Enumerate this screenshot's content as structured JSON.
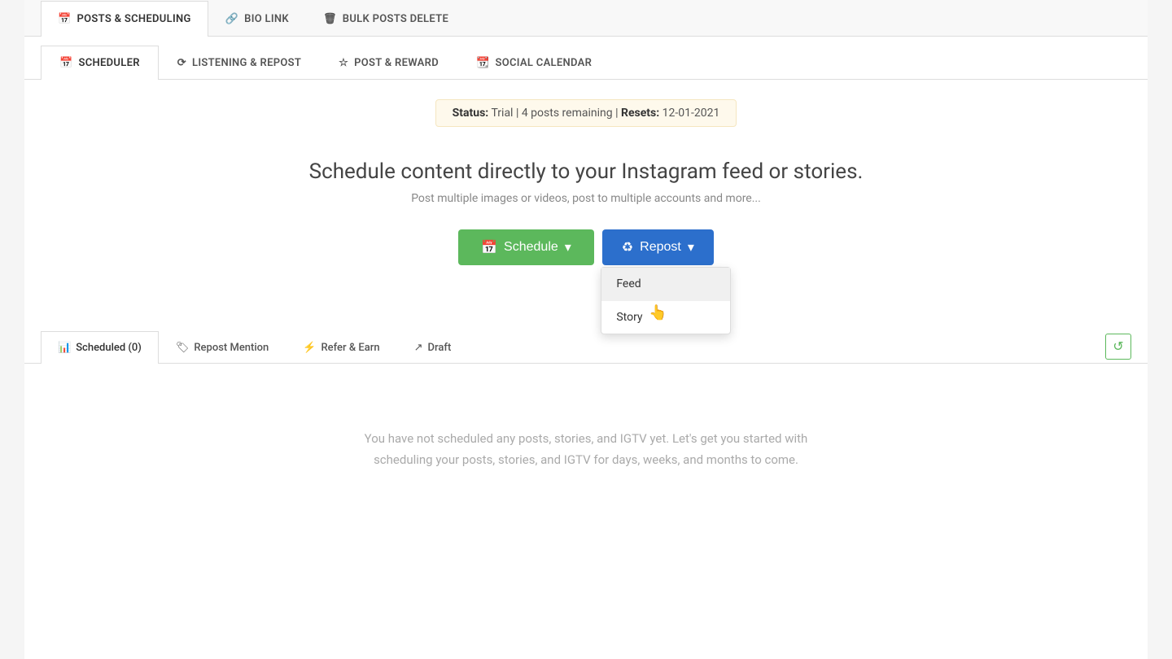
{
  "top_tabs": [
    {
      "id": "posts-scheduling",
      "icon": "📅",
      "label": "POSTS & SCHEDULING",
      "active": true
    },
    {
      "id": "bio-link",
      "icon": "🔗",
      "label": "BIO LINK",
      "active": false
    },
    {
      "id": "bulk-posts-delete",
      "icon": "🗑",
      "label": "Bulk Posts Delete",
      "active": false
    }
  ],
  "sub_tabs": [
    {
      "id": "scheduler",
      "icon": "📅",
      "label": "SCHEDULER",
      "active": true
    },
    {
      "id": "listening-repost",
      "icon": "⟳",
      "label": "LISTENING & REPOST",
      "active": false
    },
    {
      "id": "post-reward",
      "icon": "☆",
      "label": "POST & REWARD",
      "active": false
    },
    {
      "id": "social-calendar",
      "icon": "📆",
      "label": "SOCIAL CALENDAR",
      "active": false
    }
  ],
  "status": {
    "label": "Status:",
    "status_value": "Trial",
    "separator1": "|",
    "posts_label": "4 posts remaining",
    "separator2": "|",
    "resets_label": "Resets:",
    "resets_value": "12-01-2021"
  },
  "main": {
    "heading": "Schedule content directly to your Instagram feed or stories.",
    "subheading": "Post multiple images or videos, post to multiple accounts and more...",
    "schedule_button": "Schedule",
    "repost_button": "Repost",
    "dropdown_items": [
      {
        "id": "feed",
        "label": "Feed"
      },
      {
        "id": "story",
        "label": "Story"
      }
    ]
  },
  "bottom_tabs": [
    {
      "id": "scheduled",
      "icon": "📊",
      "label": "Scheduled (0)",
      "active": true
    },
    {
      "id": "repost-mention",
      "icon": "🏷",
      "label": "Repost Mention",
      "active": false
    },
    {
      "id": "refer-earn",
      "icon": "⚡",
      "label": "Refer & Earn",
      "active": false
    },
    {
      "id": "draft",
      "icon": "↗",
      "label": "Draft",
      "active": false
    }
  ],
  "empty_state": {
    "line1": "You have not scheduled any posts, stories, and IGTV yet. Let's get you started with",
    "line2": "scheduling your posts, stories, and IGTV for days, weeks, and months to come."
  },
  "icons": {
    "calendar": "📅",
    "link": "🔗",
    "trash": "🗑",
    "recycle": "♻",
    "star": "☆",
    "calendar2": "📆",
    "chart": "📊",
    "tag": "🏷",
    "bolt": "⚡",
    "share": "↗",
    "refresh": "↺",
    "cursor": "👆"
  }
}
